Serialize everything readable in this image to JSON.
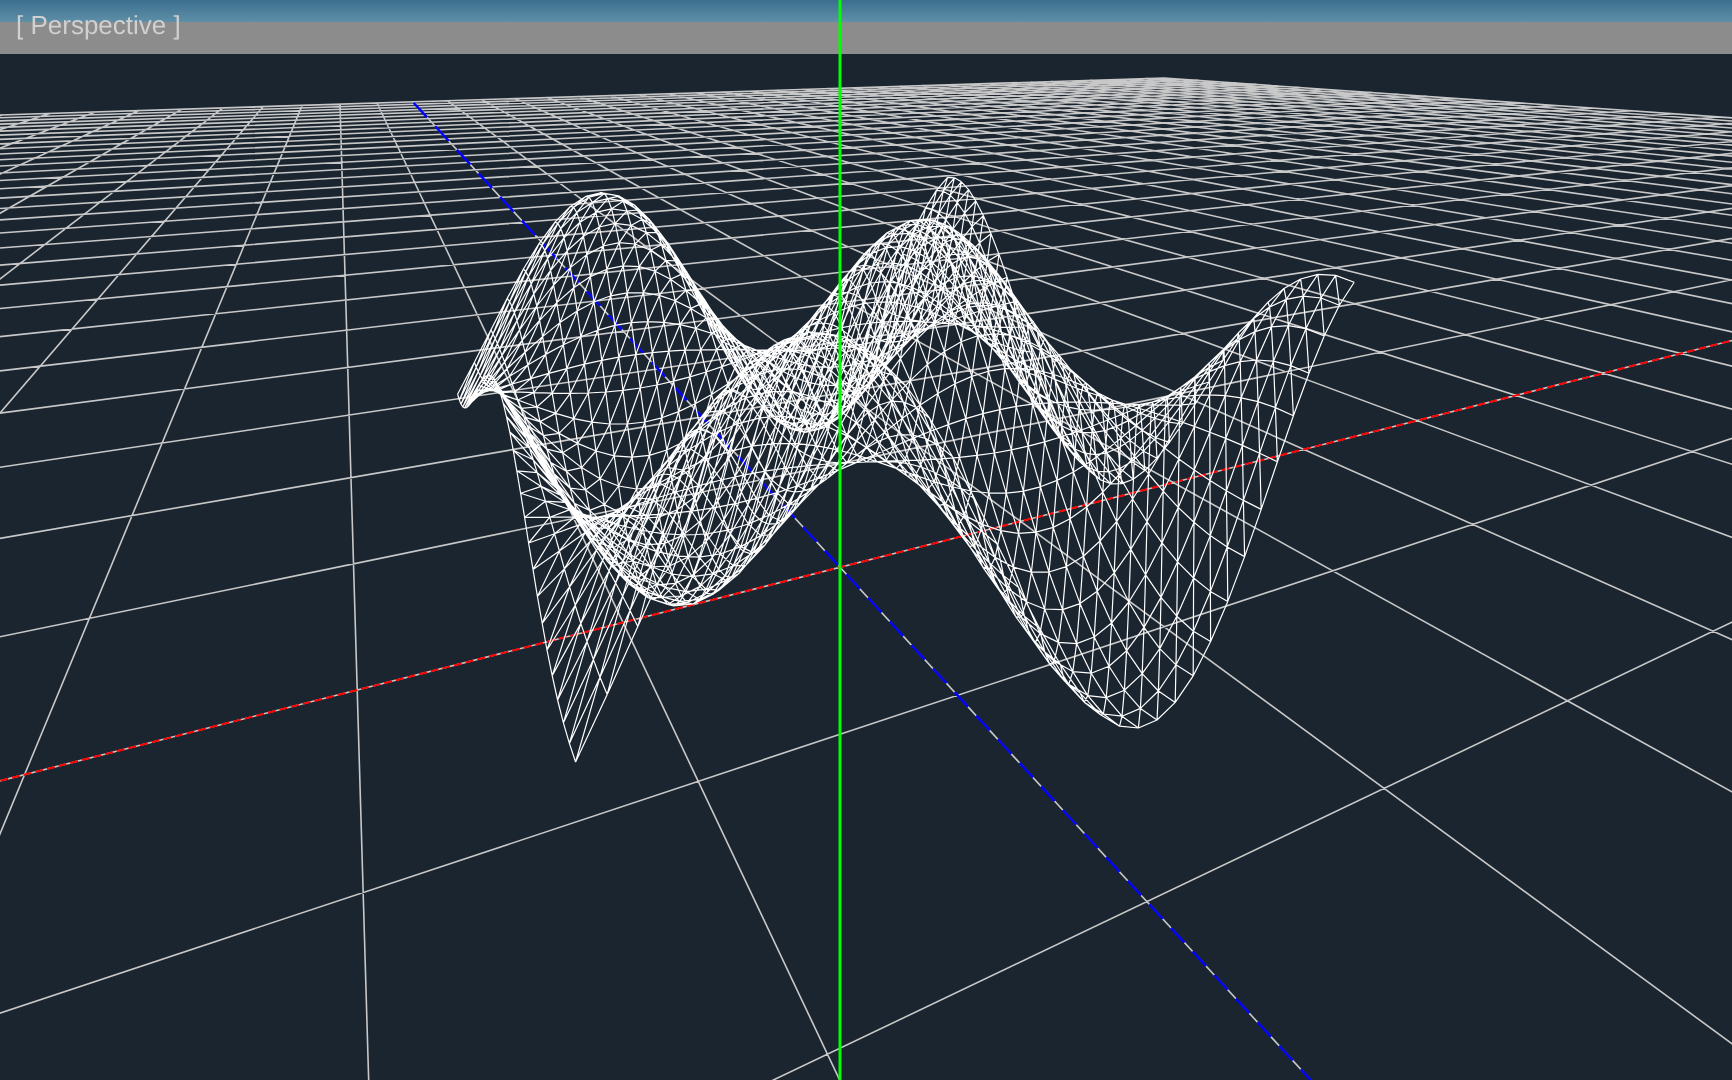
{
  "viewport": {
    "label": "[ Perspective ]"
  }
}
